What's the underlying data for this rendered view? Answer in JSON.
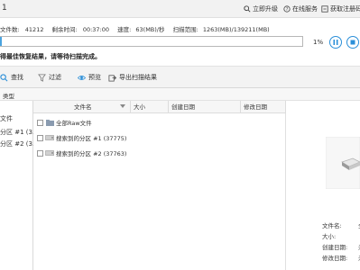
{
  "titlebar": {
    "number": "1",
    "actions": [
      {
        "label": "立即升级",
        "icon": "search-icon"
      },
      {
        "label": "在线服务",
        "icon": "help-circle-icon"
      },
      {
        "label": "获取注册码",
        "icon": "key-icon"
      }
    ]
  },
  "stats": {
    "files_label": "文件数:",
    "files_value": "41212",
    "remaining_label": "剩余时间:",
    "remaining_value": "00:37:00",
    "speed_label": "速度:",
    "speed_value": "63(MB)/秒",
    "range_label": "扫描范围:",
    "range_value": "1263(MB)/139211(MB)"
  },
  "progress": {
    "percent_text": "1%",
    "fraction": 0.01
  },
  "notice": "得最佳恢复结果，请等待扫描完成。",
  "toolbar": {
    "items": [
      {
        "label": "查找",
        "icon": "search-icon"
      },
      {
        "label": "过滤",
        "icon": "filter-icon"
      },
      {
        "label": "预览",
        "icon": "eye-icon"
      },
      {
        "label": "恢复",
        "icon": "save-icon"
      },
      {
        "label": "导出扫描结果",
        "icon": "export-icon"
      }
    ]
  },
  "type_header": "类型",
  "tree": {
    "items": [
      "文件",
      "分区 #1 (3...",
      "分区 #2 (3..."
    ]
  },
  "table": {
    "columns": [
      "文件名",
      "大小",
      "创建日期",
      "修改日期"
    ],
    "rows": [
      {
        "label": "全部Raw文件",
        "icon": "folder-icon"
      },
      {
        "label": "搜索到的分区 #1 (37775)",
        "icon": "drive-icon"
      },
      {
        "label": "搜索到的分区 #2 (37763)",
        "icon": "drive-icon"
      }
    ]
  },
  "preview": {
    "fields": [
      {
        "key": "文件名:",
        "value": "全"
      },
      {
        "key": "大小:",
        "value": ""
      },
      {
        "key": "创建日期:",
        "value": "未"
      },
      {
        "key": "修改日期:",
        "value": "未"
      }
    ]
  },
  "colors": {
    "accent": "#2b8fd8",
    "progress_fill": "#4aa3df"
  }
}
